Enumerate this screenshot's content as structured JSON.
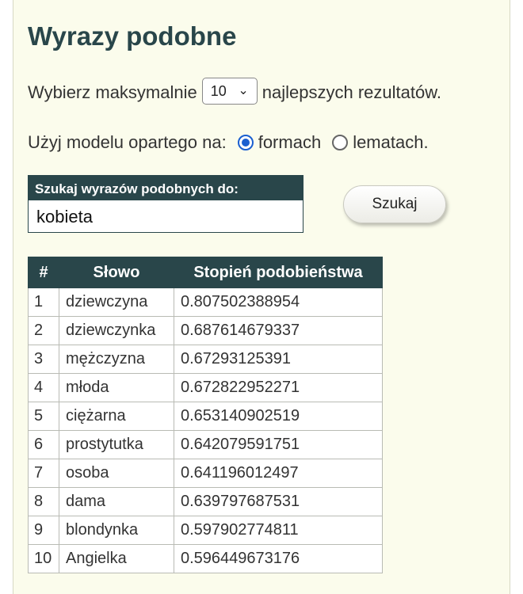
{
  "title": "Wyrazy podobne",
  "limit_row": {
    "prefix": "Wybierz maksymalnie",
    "selected": "10",
    "suffix": "najlepszych rezultatów."
  },
  "model_row": {
    "label": "Użyj modelu opartego na:",
    "option1": "formach",
    "option2": "lematach.",
    "selected": "formach"
  },
  "search": {
    "label": "Szukaj wyrazów podobnych do:",
    "value": "kobieta",
    "button": "Szukaj"
  },
  "table": {
    "headers": [
      "#",
      "Słowo",
      "Stopień podobieństwa"
    ],
    "rows": [
      [
        "1",
        "dziewczyna",
        "0.807502388954"
      ],
      [
        "2",
        "dziewczynka",
        "0.687614679337"
      ],
      [
        "3",
        "mężczyzna",
        "0.67293125391"
      ],
      [
        "4",
        "młoda",
        "0.672822952271"
      ],
      [
        "5",
        "ciężarna",
        "0.653140902519"
      ],
      [
        "6",
        "prostytutka",
        "0.642079591751"
      ],
      [
        "7",
        "osoba",
        "0.641196012497"
      ],
      [
        "8",
        "dama",
        "0.639797687531"
      ],
      [
        "9",
        "blondynka",
        "0.597902774811"
      ],
      [
        "10",
        "Angielka",
        "0.596449673176"
      ]
    ]
  }
}
